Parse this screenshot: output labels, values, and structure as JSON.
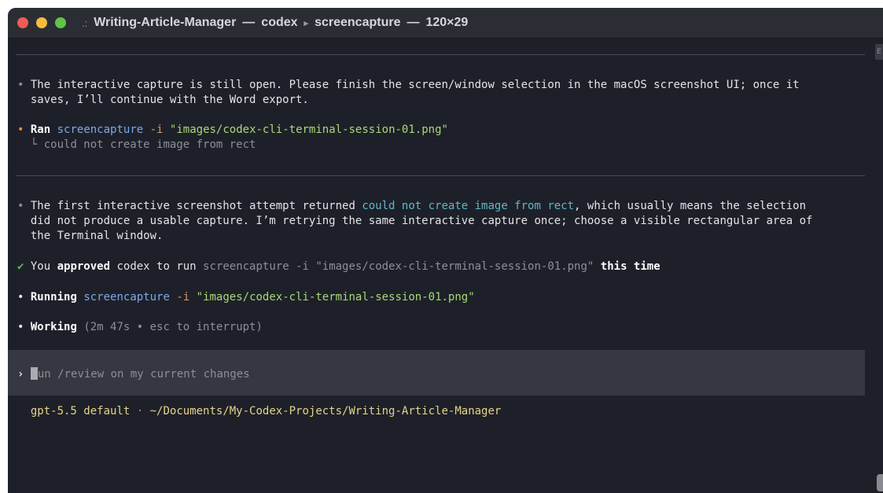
{
  "window": {
    "title_app": "Writing-Article-Manager",
    "title_dash1": "—",
    "title_proc": "codex",
    "title_arrow": "▸",
    "title_sub": "screencapture",
    "title_dash2": "—",
    "title_size": "120×29",
    "title_icon": ".:"
  },
  "terminal": {
    "msg1_line1": "The interactive capture is still open. Please finish the screen/window selection in the macOS screenshot UI; once it",
    "msg1_line2": "saves, I’ll continue with the Word export.",
    "ran_label": "Ran",
    "ran_cmd": "screencapture",
    "ran_flag": "-i",
    "ran_arg": "\"images/codex-cli-terminal-session-01.png\"",
    "ran_output_prefix": "└",
    "ran_output": "could not create image from rect",
    "msg2_line1_a": "The first interactive screenshot attempt returned ",
    "msg2_line1_code": "could not create image from rect",
    "msg2_line1_b": ", which usually means the selection",
    "msg2_line2": "did not produce a usable capture. I’m retrying the same interactive capture once; choose a visible rectangular area of",
    "msg2_line3": "the Terminal window.",
    "approve_a": "You ",
    "approve_bold": "approved",
    "approve_b": " codex to run ",
    "approve_cmd": "screencapture -i \"images/codex-cli-terminal-session-01.png\"",
    "approve_c": " ",
    "approve_bold2": "this time",
    "running_label": "Running",
    "running_cmd": "screencapture",
    "running_flag": "-i",
    "running_arg": "\"images/codex-cli-terminal-session-01.png\"",
    "working_label": "Working",
    "working_status": "(2m 47s • esc to interrupt)"
  },
  "prompt": {
    "marker": "›",
    "placeholder": "un /review on my current changes"
  },
  "footer": {
    "model": "gpt-5.5 default",
    "sep": "·",
    "path": "~/Documents/My-Codex-Projects/Writing-Article-Manager"
  },
  "glyphs": {
    "bullet": "•",
    "check": "✔"
  },
  "scroll_tab_label": "E"
}
